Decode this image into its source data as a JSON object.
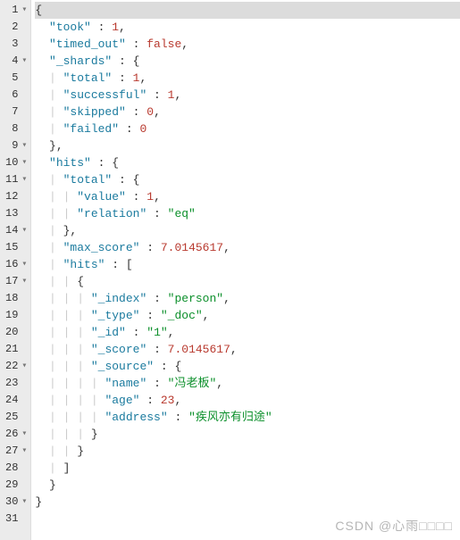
{
  "watermark": "CSDN @心雨□□□□",
  "lines": [
    {
      "num": 1,
      "fold": "▾",
      "indent": 0,
      "hl": true,
      "tokens": [
        {
          "t": "{",
          "c": "p"
        }
      ]
    },
    {
      "num": 2,
      "fold": "",
      "indent": 1,
      "tokens": [
        {
          "t": "\"took\"",
          "c": "k"
        },
        {
          "t": " : ",
          "c": "p"
        },
        {
          "t": "1",
          "c": "b"
        },
        {
          "t": ",",
          "c": "p"
        }
      ]
    },
    {
      "num": 3,
      "fold": "",
      "indent": 1,
      "tokens": [
        {
          "t": "\"timed_out\"",
          "c": "k"
        },
        {
          "t": " : ",
          "c": "p"
        },
        {
          "t": "false",
          "c": "b"
        },
        {
          "t": ",",
          "c": "p"
        }
      ]
    },
    {
      "num": 4,
      "fold": "▾",
      "indent": 1,
      "tokens": [
        {
          "t": "\"_shards\"",
          "c": "k"
        },
        {
          "t": " : {",
          "c": "p"
        }
      ]
    },
    {
      "num": 5,
      "fold": "",
      "indent": 2,
      "guides": 1,
      "tokens": [
        {
          "t": "\"total\"",
          "c": "k"
        },
        {
          "t": " : ",
          "c": "p"
        },
        {
          "t": "1",
          "c": "b"
        },
        {
          "t": ",",
          "c": "p"
        }
      ]
    },
    {
      "num": 6,
      "fold": "",
      "indent": 2,
      "guides": 1,
      "tokens": [
        {
          "t": "\"successful\"",
          "c": "k"
        },
        {
          "t": " : ",
          "c": "p"
        },
        {
          "t": "1",
          "c": "b"
        },
        {
          "t": ",",
          "c": "p"
        }
      ]
    },
    {
      "num": 7,
      "fold": "",
      "indent": 2,
      "guides": 1,
      "tokens": [
        {
          "t": "\"skipped\"",
          "c": "k"
        },
        {
          "t": " : ",
          "c": "p"
        },
        {
          "t": "0",
          "c": "b"
        },
        {
          "t": ",",
          "c": "p"
        }
      ]
    },
    {
      "num": 8,
      "fold": "",
      "indent": 2,
      "guides": 1,
      "tokens": [
        {
          "t": "\"failed\"",
          "c": "k"
        },
        {
          "t": " : ",
          "c": "p"
        },
        {
          "t": "0",
          "c": "b"
        }
      ]
    },
    {
      "num": 9,
      "fold": "▾",
      "indent": 1,
      "tokens": [
        {
          "t": "},",
          "c": "p"
        }
      ]
    },
    {
      "num": 10,
      "fold": "▾",
      "indent": 1,
      "tokens": [
        {
          "t": "\"hits\"",
          "c": "k"
        },
        {
          "t": " : {",
          "c": "p"
        }
      ]
    },
    {
      "num": 11,
      "fold": "▾",
      "indent": 2,
      "guides": 1,
      "tokens": [
        {
          "t": "\"total\"",
          "c": "k"
        },
        {
          "t": " : {",
          "c": "p"
        }
      ]
    },
    {
      "num": 12,
      "fold": "",
      "indent": 3,
      "guides": 2,
      "tokens": [
        {
          "t": "\"value\"",
          "c": "k"
        },
        {
          "t": " : ",
          "c": "p"
        },
        {
          "t": "1",
          "c": "b"
        },
        {
          "t": ",",
          "c": "p"
        }
      ]
    },
    {
      "num": 13,
      "fold": "",
      "indent": 3,
      "guides": 2,
      "tokens": [
        {
          "t": "\"relation\"",
          "c": "k"
        },
        {
          "t": " : ",
          "c": "p"
        },
        {
          "t": "\"eq\"",
          "c": "s"
        }
      ]
    },
    {
      "num": 14,
      "fold": "▾",
      "indent": 2,
      "guides": 1,
      "tokens": [
        {
          "t": "},",
          "c": "p"
        }
      ]
    },
    {
      "num": 15,
      "fold": "",
      "indent": 2,
      "guides": 1,
      "tokens": [
        {
          "t": "\"max_score\"",
          "c": "k"
        },
        {
          "t": " : ",
          "c": "p"
        },
        {
          "t": "7.0145617",
          "c": "b"
        },
        {
          "t": ",",
          "c": "p"
        }
      ]
    },
    {
      "num": 16,
      "fold": "▾",
      "indent": 2,
      "guides": 1,
      "tokens": [
        {
          "t": "\"hits\"",
          "c": "k"
        },
        {
          "t": " : [",
          "c": "p"
        }
      ]
    },
    {
      "num": 17,
      "fold": "▾",
      "indent": 3,
      "guides": 2,
      "tokens": [
        {
          "t": "{",
          "c": "p"
        }
      ]
    },
    {
      "num": 18,
      "fold": "",
      "indent": 4,
      "guides": 3,
      "tokens": [
        {
          "t": "\"_index\"",
          "c": "k"
        },
        {
          "t": " : ",
          "c": "p"
        },
        {
          "t": "\"person\"",
          "c": "s"
        },
        {
          "t": ",",
          "c": "p"
        }
      ]
    },
    {
      "num": 19,
      "fold": "",
      "indent": 4,
      "guides": 3,
      "tokens": [
        {
          "t": "\"_type\"",
          "c": "k"
        },
        {
          "t": " : ",
          "c": "p"
        },
        {
          "t": "\"_doc\"",
          "c": "s"
        },
        {
          "t": ",",
          "c": "p"
        }
      ]
    },
    {
      "num": 20,
      "fold": "",
      "indent": 4,
      "guides": 3,
      "tokens": [
        {
          "t": "\"_id\"",
          "c": "k"
        },
        {
          "t": " : ",
          "c": "p"
        },
        {
          "t": "\"1\"",
          "c": "s"
        },
        {
          "t": ",",
          "c": "p"
        }
      ]
    },
    {
      "num": 21,
      "fold": "",
      "indent": 4,
      "guides": 3,
      "tokens": [
        {
          "t": "\"_score\"",
          "c": "k"
        },
        {
          "t": " : ",
          "c": "p"
        },
        {
          "t": "7.0145617",
          "c": "b"
        },
        {
          "t": ",",
          "c": "p"
        }
      ]
    },
    {
      "num": 22,
      "fold": "▾",
      "indent": 4,
      "guides": 3,
      "tokens": [
        {
          "t": "\"_source\"",
          "c": "k"
        },
        {
          "t": " : {",
          "c": "p"
        }
      ]
    },
    {
      "num": 23,
      "fold": "",
      "indent": 5,
      "guides": 4,
      "tokens": [
        {
          "t": "\"name\"",
          "c": "k"
        },
        {
          "t": " : ",
          "c": "p"
        },
        {
          "t": "\"冯老板\"",
          "c": "s"
        },
        {
          "t": ",",
          "c": "p"
        }
      ]
    },
    {
      "num": 24,
      "fold": "",
      "indent": 5,
      "guides": 4,
      "tokens": [
        {
          "t": "\"age\"",
          "c": "k"
        },
        {
          "t": " : ",
          "c": "p"
        },
        {
          "t": "23",
          "c": "b"
        },
        {
          "t": ",",
          "c": "p"
        }
      ]
    },
    {
      "num": 25,
      "fold": "",
      "indent": 5,
      "guides": 4,
      "tokens": [
        {
          "t": "\"address\"",
          "c": "k"
        },
        {
          "t": " : ",
          "c": "p"
        },
        {
          "t": "\"疾风亦有归途\"",
          "c": "s"
        }
      ]
    },
    {
      "num": 26,
      "fold": "▾",
      "indent": 4,
      "guides": 3,
      "tokens": [
        {
          "t": "}",
          "c": "p"
        }
      ]
    },
    {
      "num": 27,
      "fold": "▾",
      "indent": 3,
      "guides": 2,
      "tokens": [
        {
          "t": "}",
          "c": "p"
        }
      ]
    },
    {
      "num": 28,
      "fold": "",
      "indent": 2,
      "guides": 1,
      "tokens": [
        {
          "t": "]",
          "c": "p"
        }
      ]
    },
    {
      "num": 29,
      "fold": "",
      "indent": 1,
      "tokens": [
        {
          "t": "}",
          "c": "p"
        }
      ]
    },
    {
      "num": 30,
      "fold": "▾",
      "indent": 0,
      "tokens": [
        {
          "t": "}",
          "c": "p"
        }
      ]
    },
    {
      "num": 31,
      "fold": "",
      "indent": 0,
      "tokens": []
    }
  ]
}
